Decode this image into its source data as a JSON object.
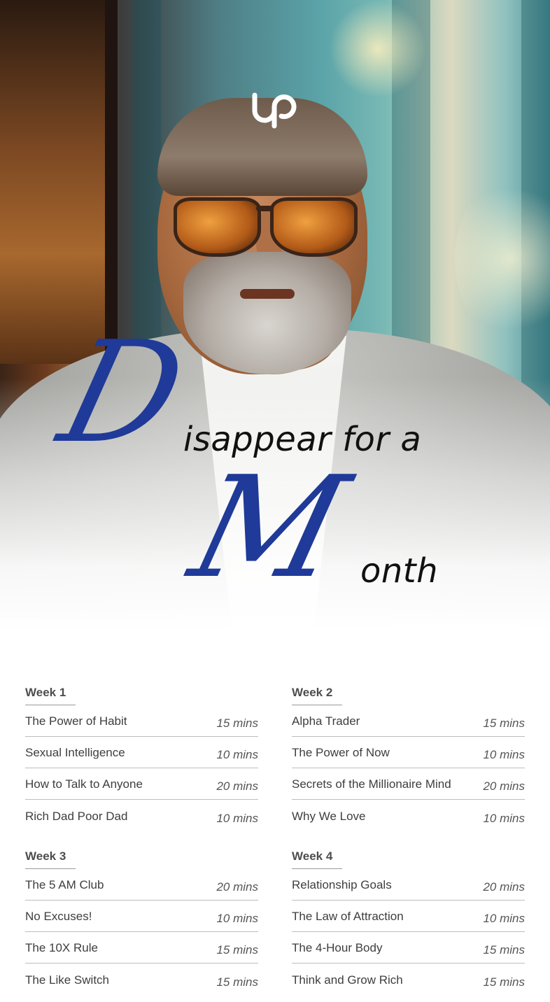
{
  "brand": {
    "logo_text": "up"
  },
  "title": {
    "initial_1": "D",
    "rest_1": "isappear for a",
    "initial_2": "M",
    "rest_2": "onth"
  },
  "weeks": [
    {
      "label": "Week 1",
      "items": [
        {
          "title": "The Power of Habit",
          "duration": "15 mins"
        },
        {
          "title": "Sexual Intelligence",
          "duration": "10 mins"
        },
        {
          "title": "How to Talk to Anyone",
          "duration": "20 mins"
        },
        {
          "title": "Rich Dad Poor Dad",
          "duration": "10 mins"
        }
      ]
    },
    {
      "label": "Week 2",
      "items": [
        {
          "title": "Alpha Trader",
          "duration": "15 mins"
        },
        {
          "title": "The Power of Now",
          "duration": "10 mins"
        },
        {
          "title": "Secrets of the Millionaire Mind",
          "duration": "20 mins"
        },
        {
          "title": "Why We Love",
          "duration": "10 mins"
        }
      ]
    },
    {
      "label": "Week 3",
      "items": [
        {
          "title": "The 5 AM Club",
          "duration": "20 mins"
        },
        {
          "title": "No Excuses!",
          "duration": "10 mins"
        },
        {
          "title": "The 10X Rule",
          "duration": "15 mins"
        },
        {
          "title": "The Like Switch",
          "duration": "15 mins"
        }
      ]
    },
    {
      "label": "Week 4",
      "items": [
        {
          "title": "Relationship Goals",
          "duration": "20 mins"
        },
        {
          "title": "The Law of Attraction",
          "duration": "10 mins"
        },
        {
          "title": "The 4-Hour Body",
          "duration": "15 mins"
        },
        {
          "title": "Think and Grow Rich",
          "duration": "15 mins"
        }
      ]
    }
  ],
  "colors": {
    "accent": "#1f3a98",
    "text": "#3e3e3e"
  }
}
